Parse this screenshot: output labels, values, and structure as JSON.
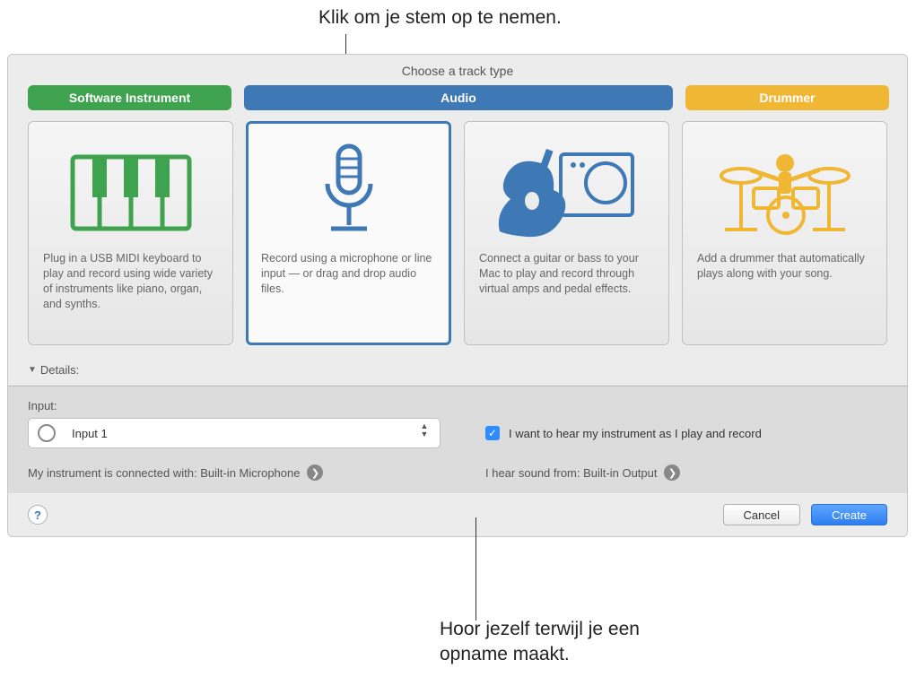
{
  "callouts": {
    "top": "Klik om je stem op te nemen.",
    "bottom_line1": "Hoor jezelf terwijl je een",
    "bottom_line2": "opname maakt."
  },
  "panel": {
    "title": "Choose a track type",
    "tabs": {
      "software": "Software Instrument",
      "audio": "Audio",
      "drummer": "Drummer"
    },
    "cards": {
      "software": "Plug in a USB MIDI keyboard to play and record using wide variety of instruments like piano, organ, and synths.",
      "audio_mic": "Record using a microphone or line input — or drag and drop audio files.",
      "audio_guitar": "Connect a guitar or bass to your Mac to play and record through virtual amps and pedal effects.",
      "drummer": "Add a drummer that automatically plays along with your song."
    },
    "details_label": "Details:"
  },
  "details": {
    "input_label": "Input:",
    "input_value": "Input 1",
    "monitor_label": "I want to hear my instrument as I play and record",
    "instrument_text": "My instrument is connected with: Built-in Microphone",
    "output_text": "I hear sound from: Built-in Output"
  },
  "buttons": {
    "help": "?",
    "cancel": "Cancel",
    "create": "Create"
  }
}
